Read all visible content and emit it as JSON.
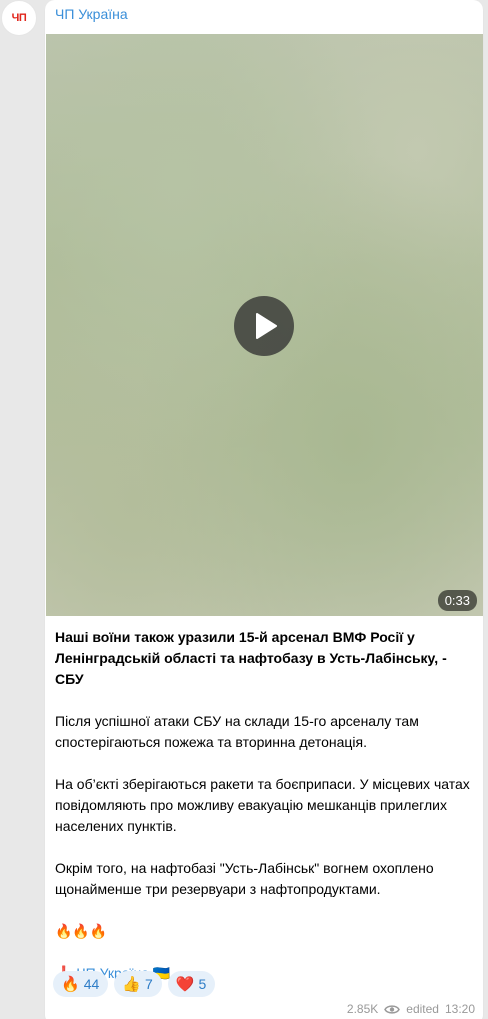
{
  "channel": {
    "name": "ЧП Україна",
    "avatar_text": "ЧП"
  },
  "video": {
    "duration": "0:33"
  },
  "post": {
    "headline": "Наші воїни також уразили 15-й арсенал ВМФ Росії у Ленінградській області та нафтобазу в Усть-Лабінську, - СБУ",
    "paragraph_1": "Після успішної атаки СБУ на склади 15-го арсеналу там спостерігаються пожежа та вторинна детонація.",
    "paragraph_2": "На об’єкті зберігаються ракети та боєприпаси. У місцевих чатах повідомляють про можливу евакуацію мешканців прилеглих населених пунктів.",
    "paragraph_3": "Окрім того, на нафтобазі \"Усть-Лабінськ\" вогнем охоплено щонайменше три резервуари з нафтопродуктами.",
    "emoji_line": "🔥🔥🔥",
    "signature_mark": "❗",
    "signature_name": "ЧП Україна",
    "signature_flag": "🇺🇦"
  },
  "reactions": [
    {
      "emoji": "🔥",
      "count": "44"
    },
    {
      "emoji": "👍",
      "count": "7"
    },
    {
      "emoji": "❤️",
      "count": "5"
    }
  ],
  "meta": {
    "views": "2.85K",
    "edited_label": "edited",
    "time": "13:20"
  },
  "colors": {
    "link": "#3a8fd9",
    "reaction_bg": "#e6f0fa",
    "background": "#e8e8e8"
  }
}
